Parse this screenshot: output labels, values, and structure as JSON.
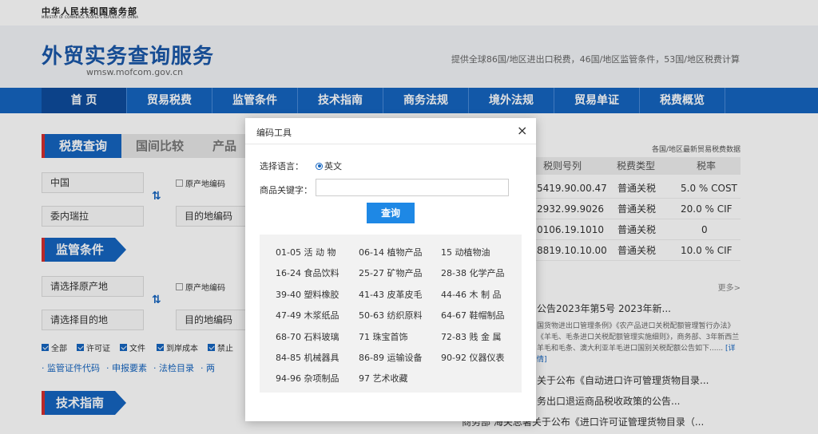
{
  "top": {
    "ministry_cn": "中华人民共和国商务部",
    "ministry_en": "MINISTRY OF COMMERCE PEOPLE'S REPUBLIC OF CHINA"
  },
  "header": {
    "title": "外贸实务查询服务",
    "url": "wmsw.mofcom.gov.cn",
    "tagline": "提供全球86国/地区进出口税费，46国/地区监管条件，53国/地区税费计算"
  },
  "nav": [
    "首 页",
    "贸易税费",
    "监管条件",
    "技术指南",
    "商务法规",
    "境外法规",
    "贸易单证",
    "税费概览"
  ],
  "tax_query": {
    "tabs": [
      "税费查询",
      "国间比较",
      "产品"
    ],
    "origin_value": "中国",
    "dest_value": "委内瑞拉",
    "origin_code_label": "原产地编码",
    "dest_code_placeholder": "目的地编码",
    "swap": "⇅"
  },
  "supervision": {
    "title": "监管条件",
    "origin_placeholder": "请选择原产地",
    "dest_placeholder": "请选择目的地",
    "origin_code_label": "原产地编码",
    "dest_code_placeholder": "目的地编码",
    "checks": [
      "全部",
      "许可证",
      "文件",
      "到岸成本",
      "禁止"
    ],
    "links": [
      "· 监管证件代码",
      "· 申报要素",
      "· 法检目录",
      "· 两"
    ]
  },
  "tech_guide": {
    "title": "技术指南"
  },
  "right": {
    "data_note": "各国/地区最新贸易税费数据",
    "columns": [
      "税则号列",
      "税费类型",
      "税率"
    ],
    "rows": [
      {
        "code": "5419.90.00.47",
        "type": "普通关税",
        "rate": "5.0 % COST"
      },
      {
        "code": "2932.99.9026",
        "type": "普通关税",
        "rate": "20.0 % CIF"
      },
      {
        "code": "0106.19.1010",
        "type": "普通关税",
        "rate": "0"
      },
      {
        "code": "8819.10.10.00",
        "type": "普通关税",
        "rate": "10.0 % CIF"
      }
    ],
    "more": "更多>",
    "news": [
      "公告2023年第5号 2023年新...",
      "关于公布《自动进口许可管理货物目录...",
      "务出口退运商品税收政策的公告...",
      "商务部 海关总署关于公布《进口许可证管理货物目录（..."
    ],
    "news_body": "国货物进出口管理条例》《农产品进口关税配额管理暂行办法》《羊毛、毛条进口关税配额管理实施细则》，商务部、3年新西兰羊毛和毛条、澳大利亚羊毛进口国别关税配额公告如下......",
    "news_detail": "[详情]"
  },
  "dialog": {
    "title": "编码工具",
    "close": "×",
    "lang_label": "选择语言：",
    "lang_option": "英文",
    "keyword_label": "商品关键字：",
    "keyword_value": "",
    "query_button": "查询",
    "chapters": [
      [
        "01-05 活  动  物",
        "06-14 植物产品",
        "15      动植物油"
      ],
      [
        "16-24 食品饮料",
        "25-27 矿物产品",
        "28-38 化学产品"
      ],
      [
        "39-40 塑料橡胶",
        "41-43 皮革皮毛",
        "44-46 木  制  品"
      ],
      [
        "47-49 木浆纸品",
        "50-63 纺织原料",
        "64-67 鞋帽制品"
      ],
      [
        "68-70 石料玻璃",
        "71      珠宝首饰",
        "72-83 贱  金  属"
      ],
      [
        "84-85 机械器具",
        "86-89 运输设备",
        "90-92 仪器仪表"
      ],
      [
        "94-96 杂项制品",
        "97      艺术收藏"
      ]
    ]
  },
  "colors": {
    "brand_blue": "#1565c0",
    "accent_red": "#d32f2f",
    "button_blue": "#1e88e5"
  }
}
